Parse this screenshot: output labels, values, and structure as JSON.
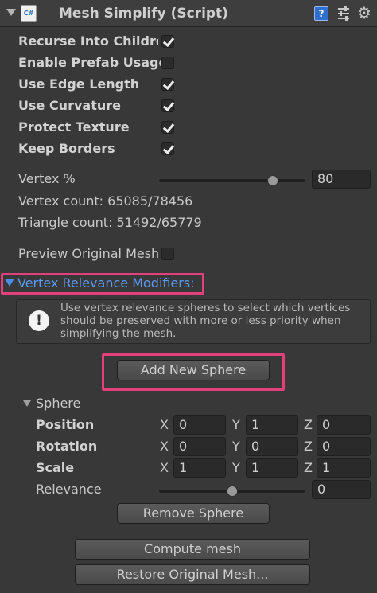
{
  "component": {
    "title": "Mesh Simplify (Script)",
    "script_icon_label": "C#"
  },
  "toggles": [
    {
      "label": "Recurse Into Children",
      "checked": true
    },
    {
      "label": "Enable Prefab Usage",
      "checked": false
    },
    {
      "label": "Use Edge Length",
      "checked": true
    },
    {
      "label": "Use Curvature",
      "checked": true
    },
    {
      "label": "Protect Texture",
      "checked": true
    },
    {
      "label": "Keep Borders",
      "checked": true
    }
  ],
  "vertex_percent": {
    "label": "Vertex %",
    "value": "80",
    "slider_fraction": 0.8
  },
  "vertex_count": "Vertex count: 65085/78456",
  "triangle_count": "Triangle count: 51492/65779",
  "preview": {
    "label": "Preview Original Mesh",
    "checked": false
  },
  "relevance_section": {
    "label": "Vertex Relevance Modifiers:",
    "help_text": "Use vertex relevance spheres to select which vertices should be preserved with more or less priority when simplifying the mesh.",
    "add_button": "Add New Sphere"
  },
  "sphere": {
    "label": "Sphere",
    "position": {
      "label": "Position",
      "x": "0",
      "y": "1",
      "z": "0"
    },
    "rotation": {
      "label": "Rotation",
      "x": "0",
      "y": "0",
      "z": "0"
    },
    "scale": {
      "label": "Scale",
      "x": "1",
      "y": "1",
      "z": "1"
    },
    "axes": {
      "x": "X",
      "y": "Y",
      "z": "Z"
    },
    "relevance": {
      "label": "Relevance",
      "value": "0",
      "slider_fraction": 0.5
    },
    "remove_button": "Remove Sphere"
  },
  "actions": {
    "compute": "Compute mesh",
    "restore": "Restore Original Mesh..."
  }
}
